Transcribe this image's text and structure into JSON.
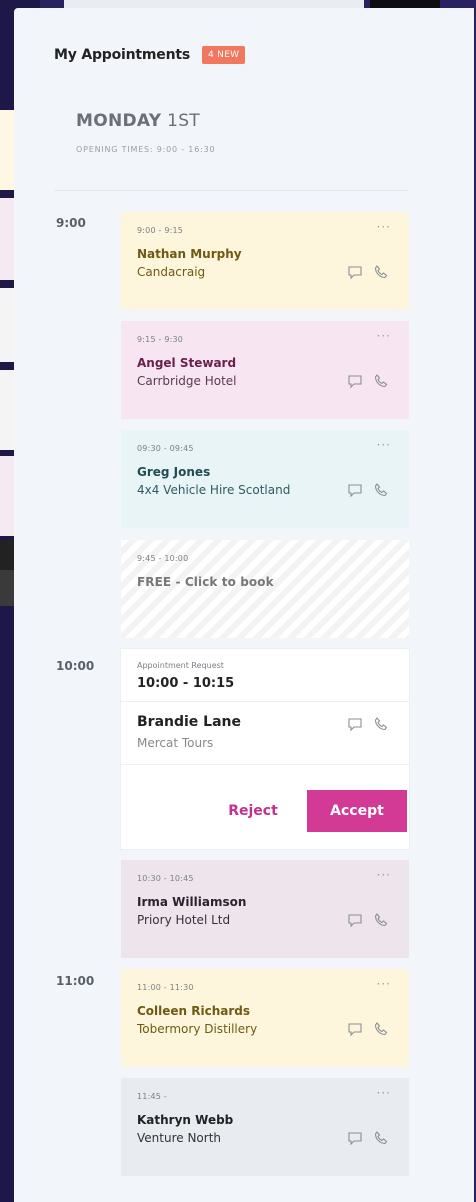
{
  "header": {
    "title": "My Appointments",
    "badge": "4 NEW"
  },
  "day": {
    "name": "MONDAY",
    "date": "1ST",
    "opening_times": "OPENING TIMES: 9:00 - 16:30"
  },
  "hours": [
    "9:00",
    "10:00",
    "11:00"
  ],
  "appointments": [
    {
      "time": "9:00 - 9:15",
      "name": "Nathan Murphy",
      "org": "Candacraig"
    },
    {
      "time": "9:15 - 9:30",
      "name": "Angel Steward",
      "org": "Carrbridge Hotel"
    },
    {
      "time": "09:30 - 09:45",
      "name": "Greg Jones",
      "org": "4x4 Vehicle Hire Scotland"
    },
    {
      "time": "10:30 - 10:45",
      "name": "Irma Williamson",
      "org": "Priory Hotel Ltd"
    },
    {
      "time": "11:00 - 11:30",
      "name": "Colleen Richards",
      "org": "Tobermory Distillery"
    },
    {
      "time": "11:45 -",
      "name": "Kathryn Webb",
      "org": "Venture North"
    }
  ],
  "free_slot": {
    "time": "9:45 - 10:00",
    "label": "FREE - Click to book"
  },
  "request": {
    "label": "Appointment Request",
    "time": "10:00 - 10:15",
    "name": "Brandie Lane",
    "org": "Mercat Tours",
    "reject_label": "Reject",
    "accept_label": "Accept"
  },
  "menu_glyph": "···",
  "icons": {
    "message": "message-icon",
    "phone": "phone-icon"
  },
  "colors": {
    "accent": "#d23a95",
    "badge": "#f26a4f"
  }
}
